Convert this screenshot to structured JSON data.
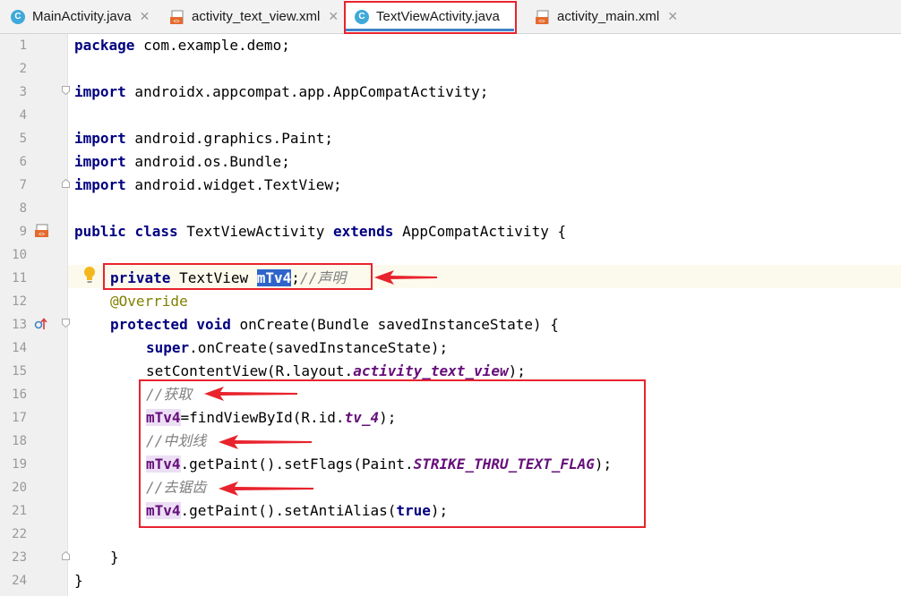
{
  "tabs": [
    {
      "label": "MainActivity.java",
      "type": "java",
      "active": false
    },
    {
      "label": "activity_text_view.xml",
      "type": "xml",
      "active": false
    },
    {
      "label": "TextViewActivity.java",
      "type": "java",
      "active": true
    },
    {
      "label": "activity_main.xml",
      "type": "xml",
      "active": false
    }
  ],
  "tab_close_glyph": "✕",
  "line_numbers": [
    "1",
    "2",
    "3",
    "4",
    "5",
    "6",
    "7",
    "8",
    "9",
    "10",
    "11",
    "12",
    "13",
    "14",
    "15",
    "16",
    "17",
    "18",
    "19",
    "20",
    "21",
    "22",
    "23",
    "24"
  ],
  "code": {
    "l1": {
      "kw": "package",
      "rest": " com.example.demo;"
    },
    "l3": {
      "kw": "import",
      "rest": " androidx.appcompat.app.AppCompatActivity;"
    },
    "l5": {
      "kw": "import",
      "rest": " android.graphics.Paint;"
    },
    "l6": {
      "kw": "import",
      "rest": " android.os.Bundle;"
    },
    "l7": {
      "kw": "import",
      "rest": " android.widget.TextView;"
    },
    "l9": {
      "kw1": "public",
      "kw2": "class",
      "name": " TextViewActivity ",
      "kw3": "extends",
      "rest": " AppCompatActivity {"
    },
    "l11": {
      "kw": "private",
      "type": " TextView ",
      "field": "mTv4",
      "semi": ";",
      "comment": "//声明"
    },
    "l12": {
      "ann": "@Override"
    },
    "l13": {
      "kw1": "protected",
      "kw2": "void",
      "rest": " onCreate(Bundle savedInstanceState) {"
    },
    "l14": {
      "kw": "super",
      "rest": ".onCreate(savedInstanceState);"
    },
    "l15": {
      "pre": "setContentView(R.layout.",
      "ital": "activity_text_view",
      "post": ");"
    },
    "l16": {
      "comment": "//获取"
    },
    "l17": {
      "field": "mTv4",
      "pre": "=findViewById(R.id.",
      "ital": "tv_4",
      "post": ");"
    },
    "l18": {
      "comment": "//中划线"
    },
    "l19": {
      "field": "mTv4",
      "pre": ".getPaint().setFlags(Paint.",
      "ital": "STRIKE_THRU_TEXT_FLAG",
      "post": ");"
    },
    "l20": {
      "comment": "//去锯齿"
    },
    "l21": {
      "field": "mTv4",
      "pre": ".getPaint().setAntiAlias(",
      "kw": "true",
      "post": ");"
    },
    "l23": {
      "rest": "}"
    },
    "l24": {
      "rest": "}"
    }
  },
  "colors": {
    "annotation_red": "#e8232d",
    "keyword": "#000080",
    "comment": "#808080",
    "field": "#660e7a",
    "selection": "#2f65ca",
    "tab_underline": "#4083c9"
  },
  "icons": [
    "java-class-icon",
    "xml-layout-icon",
    "lightbulb-icon",
    "override-method-icon",
    "fold-icon"
  ]
}
